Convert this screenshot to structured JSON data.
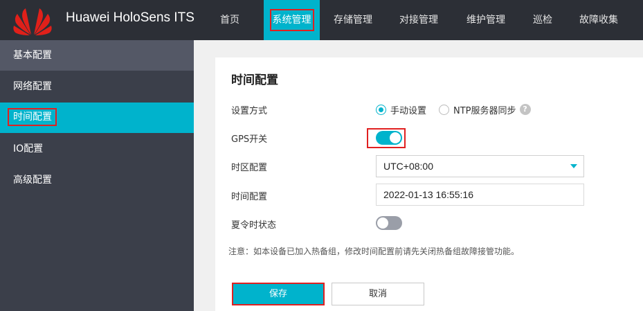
{
  "app": {
    "title": "Huawei HoloSens ITS"
  },
  "nav": {
    "items": [
      {
        "label": "首页"
      },
      {
        "label": "系统管理"
      },
      {
        "label": "存储管理"
      },
      {
        "label": "对接管理"
      },
      {
        "label": "维护管理"
      },
      {
        "label": "巡检"
      },
      {
        "label": "故障收集"
      }
    ],
    "active": "系统管理"
  },
  "sidebar": {
    "items": [
      {
        "label": "基本配置"
      },
      {
        "label": "网络配置"
      },
      {
        "label": "时间配置"
      },
      {
        "label": "IO配置"
      },
      {
        "label": "高级配置"
      }
    ],
    "active": "时间配置"
  },
  "panel": {
    "title": "时间配置",
    "setting_mode": {
      "label": "设置方式",
      "options": [
        {
          "label": "手动设置",
          "checked": true
        },
        {
          "label": "NTP服务器同步",
          "checked": false
        }
      ],
      "help_icon": "question-icon"
    },
    "gps": {
      "label": "GPS开关",
      "enabled": true
    },
    "timezone": {
      "label": "时区配置",
      "value": "UTC+08:00"
    },
    "time": {
      "label": "时间配置",
      "value": "2022-01-13 16:55:16"
    },
    "dst": {
      "label": "夏令时状态",
      "enabled": false
    },
    "note": "注意：如本设备已加入热备组，修改时间配置前请先关闭热备组故障接管功能。",
    "buttons": {
      "save": "保存",
      "cancel": "取消"
    }
  },
  "colors": {
    "accent": "#00b3cc",
    "topbar": "#2c2f36",
    "sidebar": "#3b3f4a",
    "highlight": "#e02020",
    "brand_red": "#e0201a"
  }
}
